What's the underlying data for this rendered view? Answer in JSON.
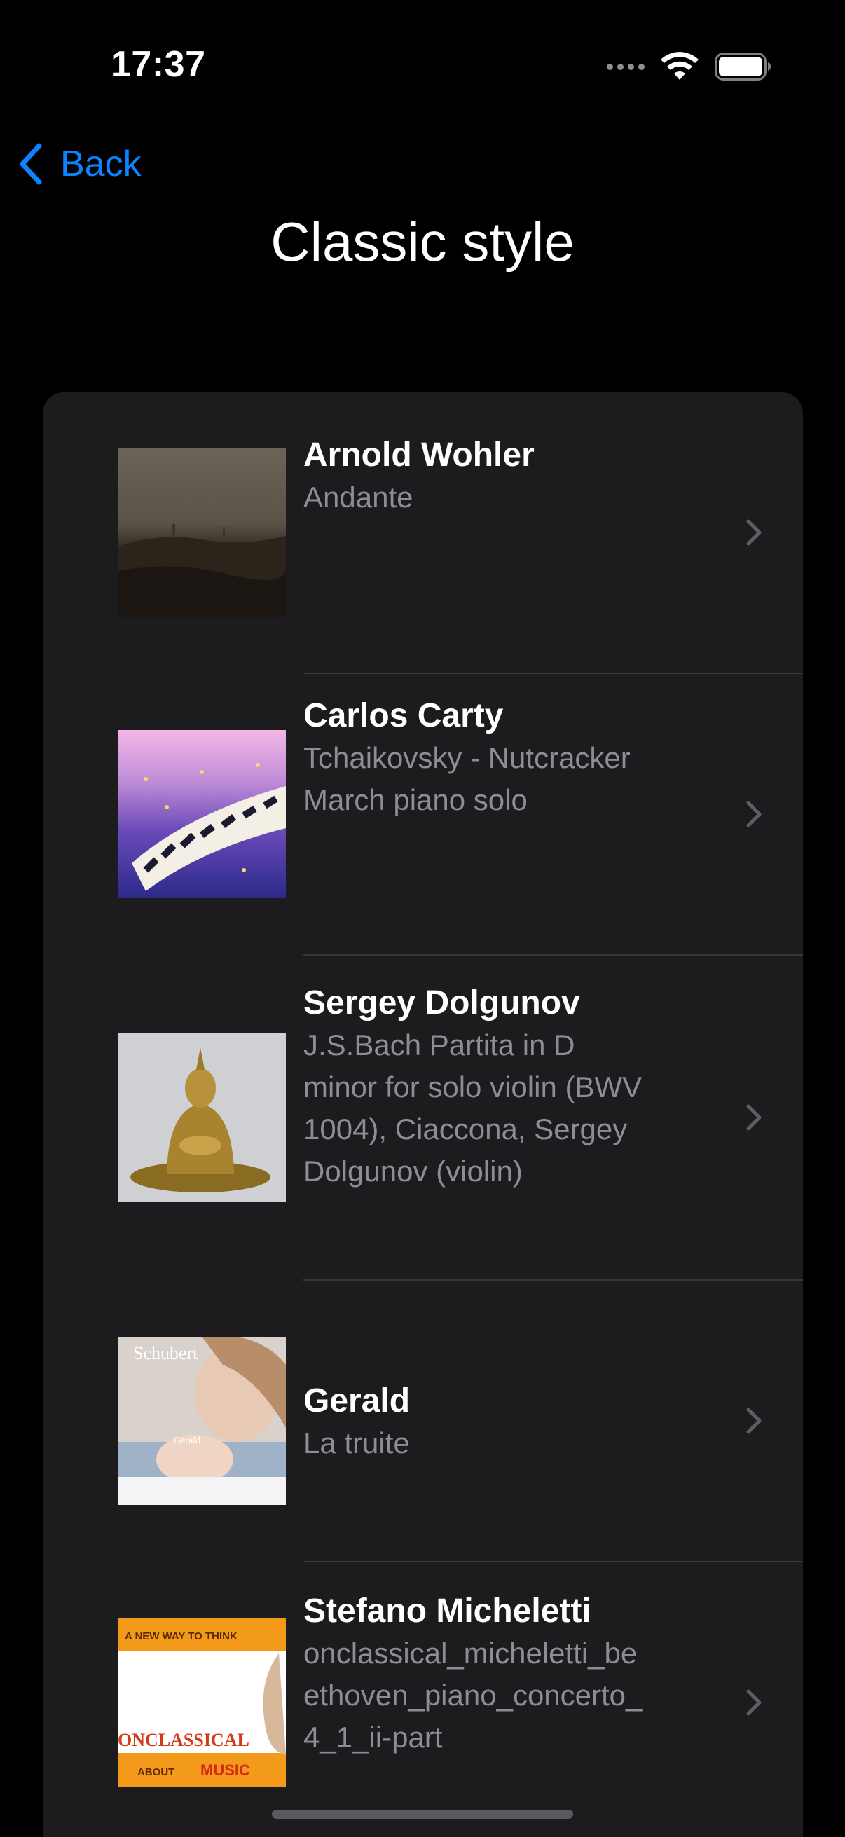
{
  "status_bar": {
    "time": "17:37"
  },
  "nav": {
    "back_label": "Back",
    "title": "Classic style"
  },
  "items": [
    {
      "title": "Arnold Wohler",
      "subtitle_lines": [
        "Andante"
      ]
    },
    {
      "title": "Carlos Carty",
      "subtitle_lines": [
        "Tchaikovsky - Nutcracker",
        "March piano solo"
      ]
    },
    {
      "title": "Sergey Dolgunov",
      "subtitle_lines": [
        "J.S.Bach Partita in D",
        "minor for solo violin (BWV",
        "1004), Ciaccona, Sergey",
        "Dolgunov (violin)"
      ]
    },
    {
      "title": "Gerald",
      "subtitle_lines": [
        "La truite"
      ]
    },
    {
      "title": "Stefano Micheletti",
      "subtitle_lines": [
        "onclassical_micheletti_be",
        "ethoven_piano_concerto_",
        "4_1_ii-part"
      ]
    }
  ],
  "artwork": {
    "gerald": {
      "line1": "Schubert",
      "line2": "Gérald"
    },
    "stefano": {
      "top": "A NEW WAY TO THINK",
      "brand": "ONCLASSICAL",
      "bottom_a": "ABOUT",
      "bottom_b": "MUSIC"
    }
  },
  "colors": {
    "accent": "#0a84ff",
    "background": "#000000",
    "card": "#1c1c1e",
    "secondary_text": "#8d8d93"
  }
}
